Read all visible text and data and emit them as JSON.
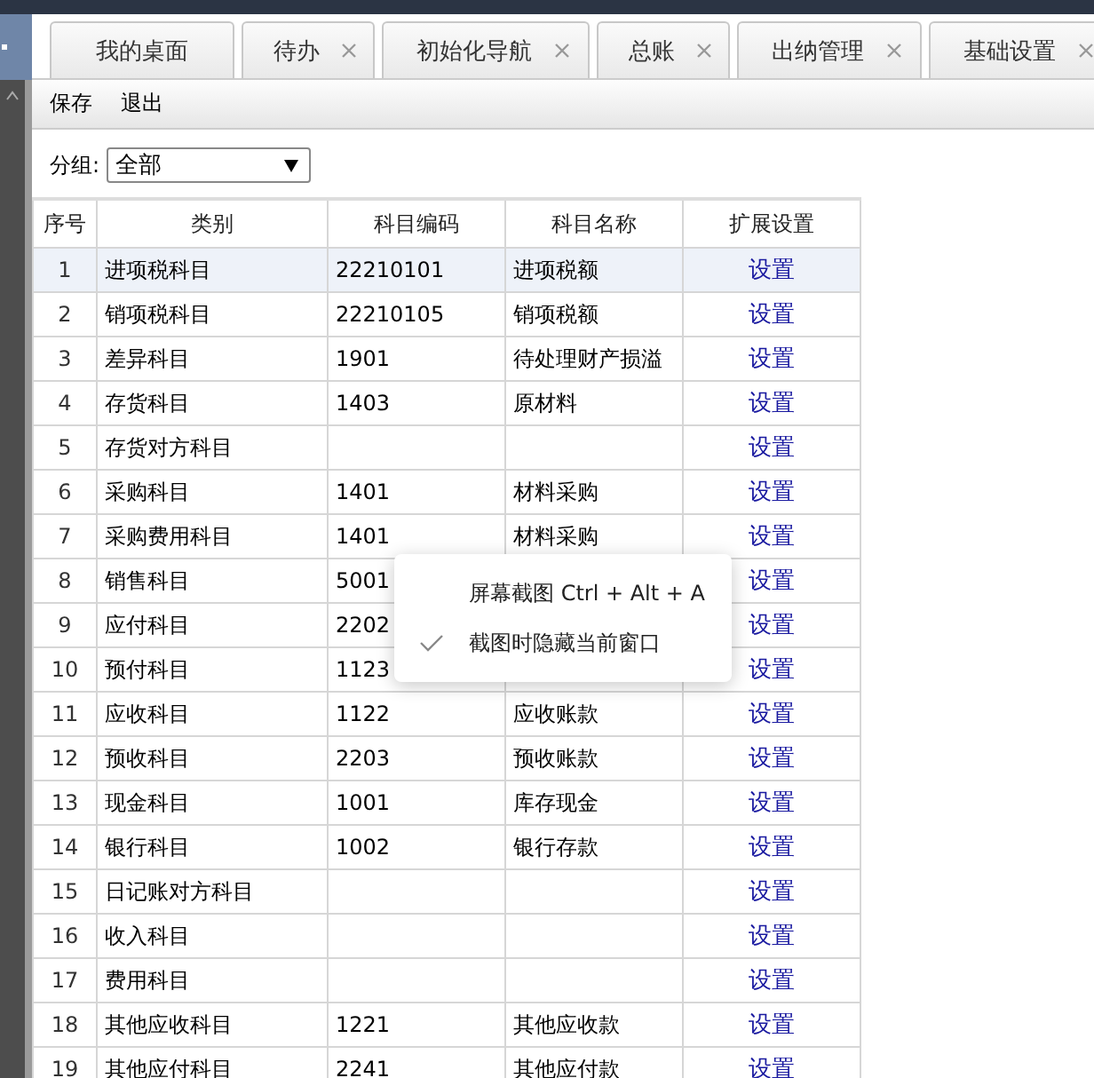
{
  "tabs": [
    {
      "label": "我的桌面",
      "closable": false,
      "selected": false
    },
    {
      "label": "待办",
      "closable": true,
      "selected": false
    },
    {
      "label": "初始化导航",
      "closable": true,
      "selected": false
    },
    {
      "label": "总账",
      "closable": true,
      "selected": false
    },
    {
      "label": "出纳管理",
      "closable": true,
      "selected": false
    },
    {
      "label": "基础设置",
      "closable": true,
      "selected": false
    }
  ],
  "toolbar": [
    "保存",
    "退出"
  ],
  "filter": {
    "label": "分组:",
    "value": "全部"
  },
  "table": {
    "columns": [
      "序号",
      "类别",
      "科目编码",
      "科目名称",
      "扩展设置"
    ],
    "rows": [
      {
        "cells": [
          "1",
          "进项税科目",
          "22210101",
          "进项税额",
          "设置"
        ],
        "selected": true
      },
      {
        "cells": [
          "2",
          "销项税科目",
          "22210105",
          "销项税额",
          "设置"
        ],
        "selected": false
      },
      {
        "cells": [
          "3",
          "差异科目",
          "1901",
          "待处理财产损溢",
          "设置"
        ],
        "selected": false
      },
      {
        "cells": [
          "4",
          "存货科目",
          "1403",
          "原材料",
          "设置"
        ],
        "selected": false
      },
      {
        "cells": [
          "5",
          "存货对方科目",
          "",
          "",
          "设置"
        ],
        "selected": false
      },
      {
        "cells": [
          "6",
          "采购科目",
          "1401",
          "材料采购",
          "设置"
        ],
        "selected": false
      },
      {
        "cells": [
          "7",
          "采购费用科目",
          "1401",
          "材料采购",
          "设置"
        ],
        "selected": false
      },
      {
        "cells": [
          "8",
          "销售科目",
          "5001",
          "",
          "设置"
        ],
        "selected": false
      },
      {
        "cells": [
          "9",
          "应付科目",
          "2202",
          "",
          "设置"
        ],
        "selected": false
      },
      {
        "cells": [
          "10",
          "预付科目",
          "1123",
          "",
          "设置"
        ],
        "selected": false
      },
      {
        "cells": [
          "11",
          "应收科目",
          "1122",
          "应收账款",
          "设置"
        ],
        "selected": false
      },
      {
        "cells": [
          "12",
          "预收科目",
          "2203",
          "预收账款",
          "设置"
        ],
        "selected": false
      },
      {
        "cells": [
          "13",
          "现金科目",
          "1001",
          "库存现金",
          "设置"
        ],
        "selected": false
      },
      {
        "cells": [
          "14",
          "银行科目",
          "1002",
          "银行存款",
          "设置"
        ],
        "selected": false
      },
      {
        "cells": [
          "15",
          "日记账对方科目",
          "",
          "",
          "设置"
        ],
        "selected": false
      },
      {
        "cells": [
          "16",
          "收入科目",
          "",
          "",
          "设置"
        ],
        "selected": false
      },
      {
        "cells": [
          "17",
          "费用科目",
          "",
          "",
          "设置"
        ],
        "selected": false
      },
      {
        "cells": [
          "18",
          "其他应收科目",
          "1221",
          "其他应收款",
          "设置"
        ],
        "selected": false
      },
      {
        "cells": [
          "19",
          "其他应付科目",
          "2241",
          "其他应付款",
          "设置"
        ],
        "selected": false
      }
    ]
  },
  "context_menu": [
    {
      "label": "屏幕截图 Ctrl + Alt + A",
      "checked": false
    },
    {
      "label": "截图时隐藏当前窗口",
      "checked": true
    }
  ]
}
